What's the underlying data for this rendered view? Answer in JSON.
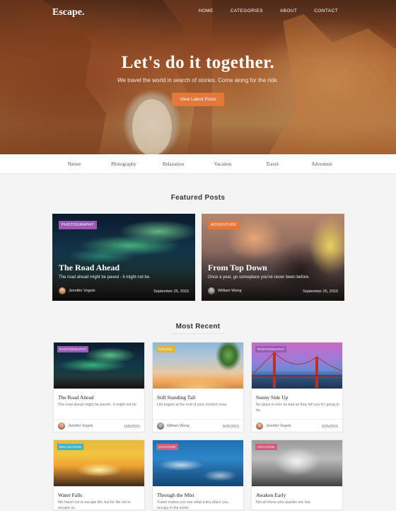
{
  "brand": "Escape.",
  "nav": [
    "HOME",
    "CATEGORIES",
    "ABOUT",
    "CONTACT"
  ],
  "hero": {
    "title": "Let's do it together.",
    "subtitle": "We travel the world in search of stories. Come along for the ride.",
    "button": "View Latest Posts"
  },
  "categories": [
    "Nature",
    "Photography",
    "Relaxation",
    "Vacation",
    "Travel",
    "Adventure"
  ],
  "featured": {
    "heading": "Featured Posts",
    "posts": [
      {
        "badge": "PHOTOGRAPHY",
        "badge_color": "#9b59b6",
        "title": "The Road Ahead",
        "excerpt": "The road ahead might be paved - it might not be.",
        "author": "Jennifer Vogels",
        "date": "September 25, 2015"
      },
      {
        "badge": "ADVENTURE",
        "badge_color": "#e4773a",
        "title": "From Top Down",
        "excerpt": "Once a year, go someplace you've never been before.",
        "author": "William Wong",
        "date": "September 25, 2015"
      }
    ]
  },
  "recent": {
    "heading": "Most Recent",
    "posts": [
      {
        "badge": "PHOTOGRAPHY",
        "badge_color": "#9b59b6",
        "title": "The Road Ahead",
        "excerpt": "The road ahead might be paved - it might not be.",
        "author": "Jennifer Vogels",
        "date": "10/5/2015"
      },
      {
        "badge": "NATURE",
        "badge_color": "#e5b53a",
        "title": "Still Standing Tall",
        "excerpt": "Life begins at the end of your comfort zone.",
        "author": "William Wong",
        "date": "9/25/2015"
      },
      {
        "badge": "PHOTOGRAPHY",
        "badge_color": "#9b59b6",
        "title": "Sunny Side Up",
        "excerpt": "No place is ever as bad as they tell you it's going to be.",
        "author": "Jennifer Vogels",
        "date": "9/25/2015"
      },
      {
        "badge": "RELAXATION",
        "badge_color": "#3fb4c7",
        "title": "Water Falls",
        "excerpt": "We travel not to escape life, but for life not to escape us."
      },
      {
        "badge": "VACATION",
        "badge_color": "#d65a7d",
        "title": "Through the Mist",
        "excerpt": "Travel makes you see what a tiny place you occupy in the world."
      },
      {
        "badge": "VACATION",
        "badge_color": "#d65a7d",
        "title": "Awaken Early",
        "excerpt": "Not all those who wander are lost."
      }
    ]
  }
}
